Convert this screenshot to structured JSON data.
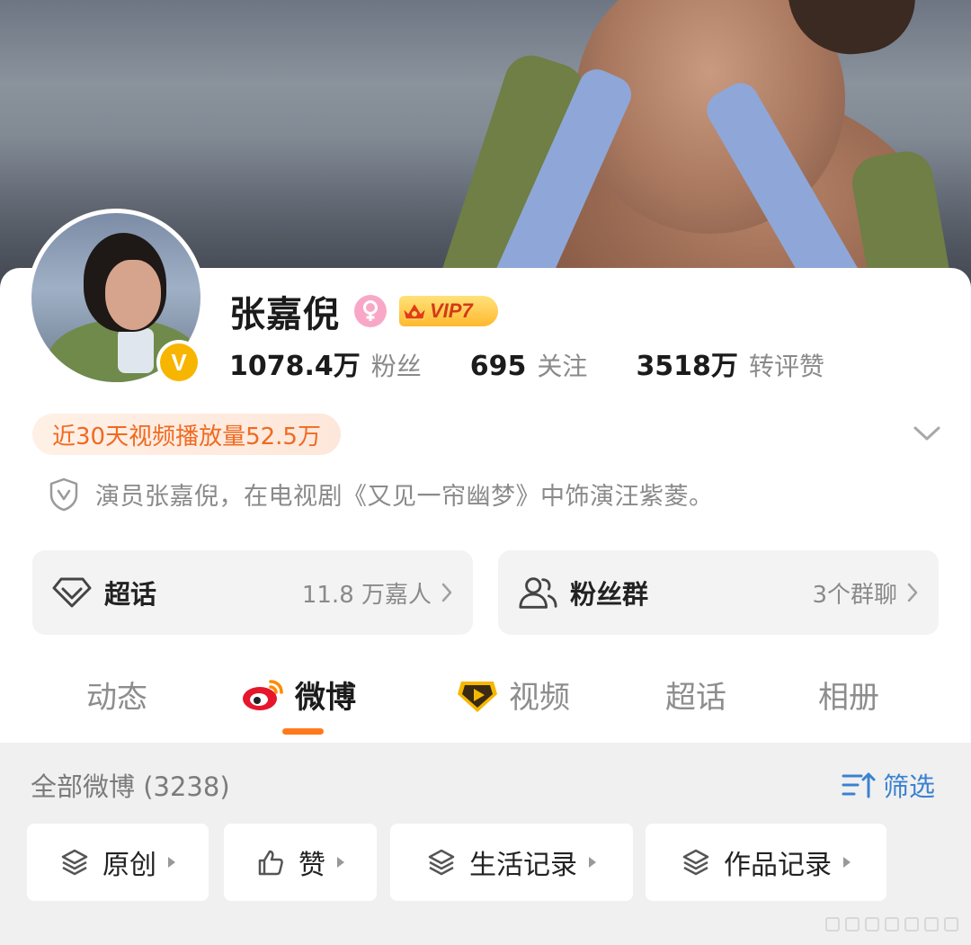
{
  "profile": {
    "name": "张嘉倪",
    "vip_label": "VIP7",
    "verified_badge": "V",
    "stats": [
      {
        "value": "1078.4万",
        "label": "粉丝"
      },
      {
        "value": "695",
        "label": "关注"
      },
      {
        "value": "3518万",
        "label": "转评赞"
      }
    ],
    "video_plays": "近30天视频播放量52.5万",
    "bio": "演员张嘉倪，在电视剧《又见一帘幽梦》中饰演汪紫菱。"
  },
  "cards": [
    {
      "title": "超话",
      "subtitle": "11.8 万嘉人",
      "icon": "diamond-icon"
    },
    {
      "title": "粉丝群",
      "subtitle": "3个群聊",
      "icon": "group-icon"
    }
  ],
  "tabs": [
    {
      "label": "动态",
      "active": false
    },
    {
      "label": "微博",
      "active": true,
      "icon": "weibo-icon"
    },
    {
      "label": "视频",
      "active": false,
      "icon": "video-badge-icon"
    },
    {
      "label": "超话",
      "active": false
    },
    {
      "label": "相册",
      "active": false
    }
  ],
  "feed": {
    "all_posts": "全部微博 (3238)",
    "filter_label": "筛选",
    "chips": [
      {
        "label": "原创",
        "icon": "layers-icon"
      },
      {
        "label": "赞",
        "icon": "thumb-up-icon"
      },
      {
        "label": "生活记录",
        "icon": "layers-icon"
      },
      {
        "label": "作品记录",
        "icon": "layers-icon"
      }
    ]
  },
  "colors": {
    "accent_orange": "#ff7a1c",
    "link_blue": "#3b82d0",
    "vip_gold": "#ffb92e",
    "verified_gold": "#f7b500",
    "gender_pink": "#f8a8c6"
  }
}
